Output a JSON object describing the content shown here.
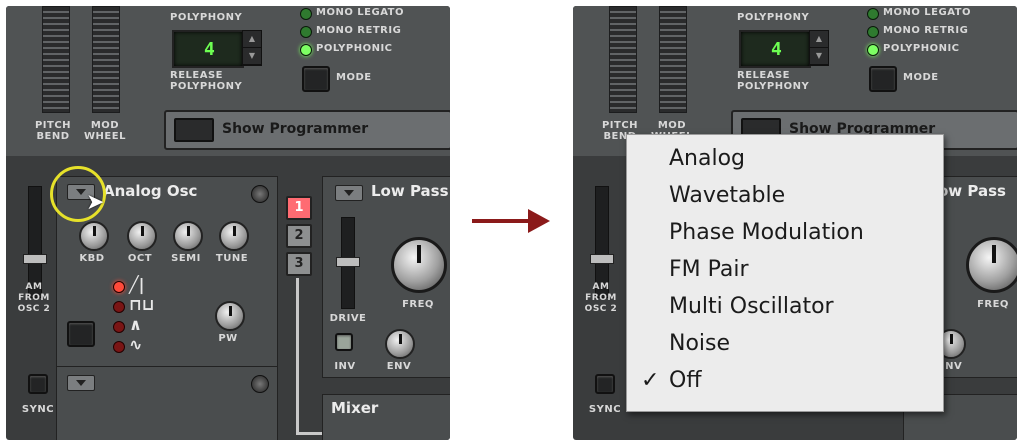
{
  "left": {
    "polyphony_label": "POLYPHONY",
    "polyphony_value": "4",
    "release_label": "RELEASE POLYPHONY",
    "modes": [
      "MONO LEGATO",
      "MONO RETRIG",
      "POLYPHONIC"
    ],
    "mode_button_label": "MODE",
    "pitch_bend_label": "PITCH BEND",
    "mod_wheel_label": "MOD WHEEL",
    "show_programmer_label": "Show Programmer",
    "osc_title": "Analog Osc",
    "osc_knobs": [
      "KBD",
      "OCT",
      "SEMI",
      "TUNE"
    ],
    "pw_label": "PW",
    "am_label": "AM FROM OSC 2",
    "sync_label": "SYNC",
    "filter_title": "Low Pass",
    "filter_buttons": [
      "1",
      "2",
      "3"
    ],
    "drive_label": "DRIVE",
    "freq_label": "FREQ",
    "inv_label": "INV",
    "env_label": "ENV",
    "mixer_title": "Mixer"
  },
  "right": {
    "polyphony_label": "POLYPHONY",
    "polyphony_value": "4",
    "release_label": "RELEASE POLYPHONY",
    "modes": [
      "MONO LEGATO",
      "MONO RETRIG",
      "POLYPHONIC"
    ],
    "mode_button_label": "MODE",
    "pitch_bend_label": "PITCH BEND",
    "mod_wheel_label": "MOD WHEEL",
    "show_programmer_label": "Show Programmer",
    "filter_title_partial": "ow Pass",
    "am_label": "AM FROM OSC 2",
    "sync_label": "SYNC",
    "freq_label": "FREQ",
    "env_label": "ENV"
  },
  "menu": {
    "items": [
      "Analog",
      "Wavetable",
      "Phase Modulation",
      "FM Pair",
      "Multi Oscillator",
      "Noise",
      "Off"
    ],
    "selected_index": 6,
    "check_glyph": "✓"
  },
  "icons": {
    "arrow": "arrow-right-icon",
    "cursor": "mouse-cursor-icon",
    "wave_saw": "sawtooth-wave-icon",
    "wave_square": "square-wave-icon",
    "wave_triangle": "triangle-wave-icon",
    "wave_sine": "sine-wave-icon"
  },
  "colors": {
    "arrow": "#8b1a1a",
    "highlight_ring": "#e6e12a",
    "lcd_text": "#6dff52",
    "filter_button_active": "#ff6b72"
  }
}
